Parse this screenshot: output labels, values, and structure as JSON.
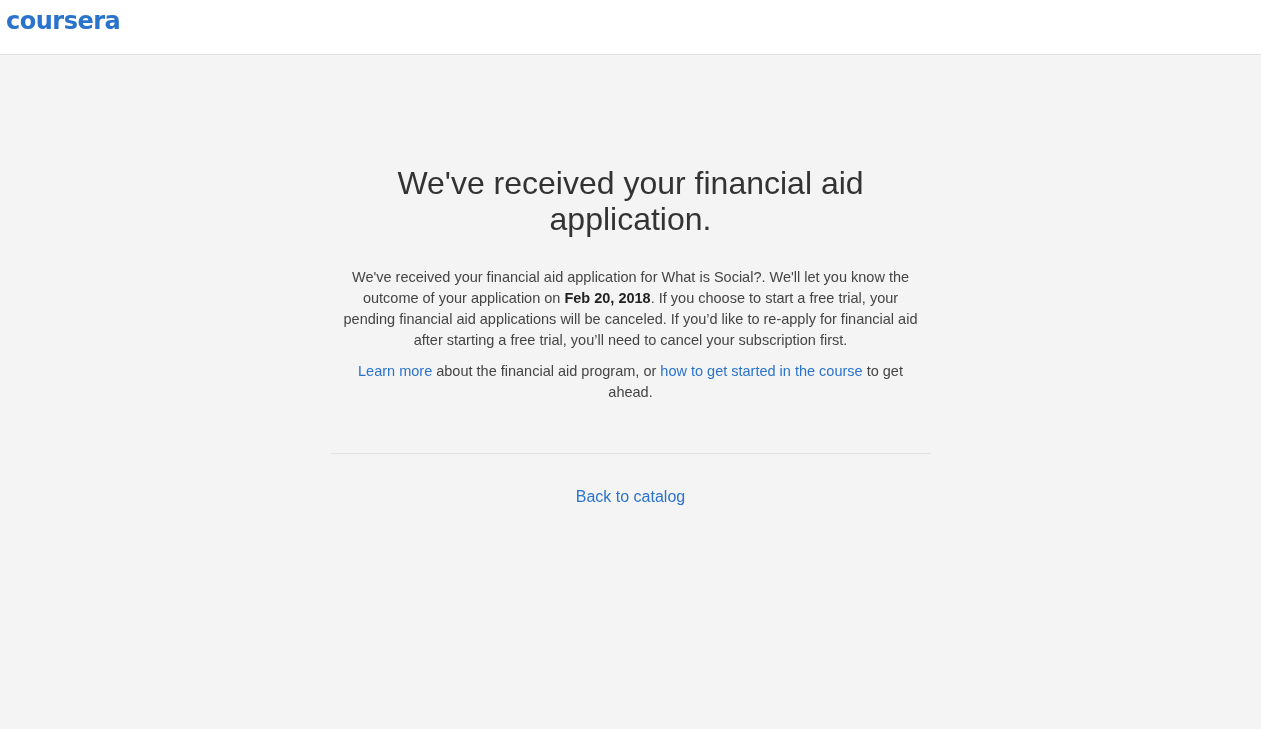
{
  "header": {
    "logo": "coursera"
  },
  "heading": "We've received your financial aid application.",
  "message": "We've received your financial aid application for What is Social?. We'll let you know the outcome of your application on **Feb 20, 2018**. If you choose to start a free trial, your pending financial aid applications will be canceled. If you’d like to re-apply for financial aid after starting a free trial, you’ll need to cancel your subscription first.",
  "links_paragraph": [
    {
      "kind": "link",
      "text": "Learn more"
    },
    {
      "kind": "text",
      "text": " about the financial aid program, or "
    },
    {
      "kind": "link",
      "text": "how to get started in the course"
    },
    {
      "kind": "text",
      "text": " to get ahead."
    }
  ],
  "footer_link": "Back to catalog"
}
